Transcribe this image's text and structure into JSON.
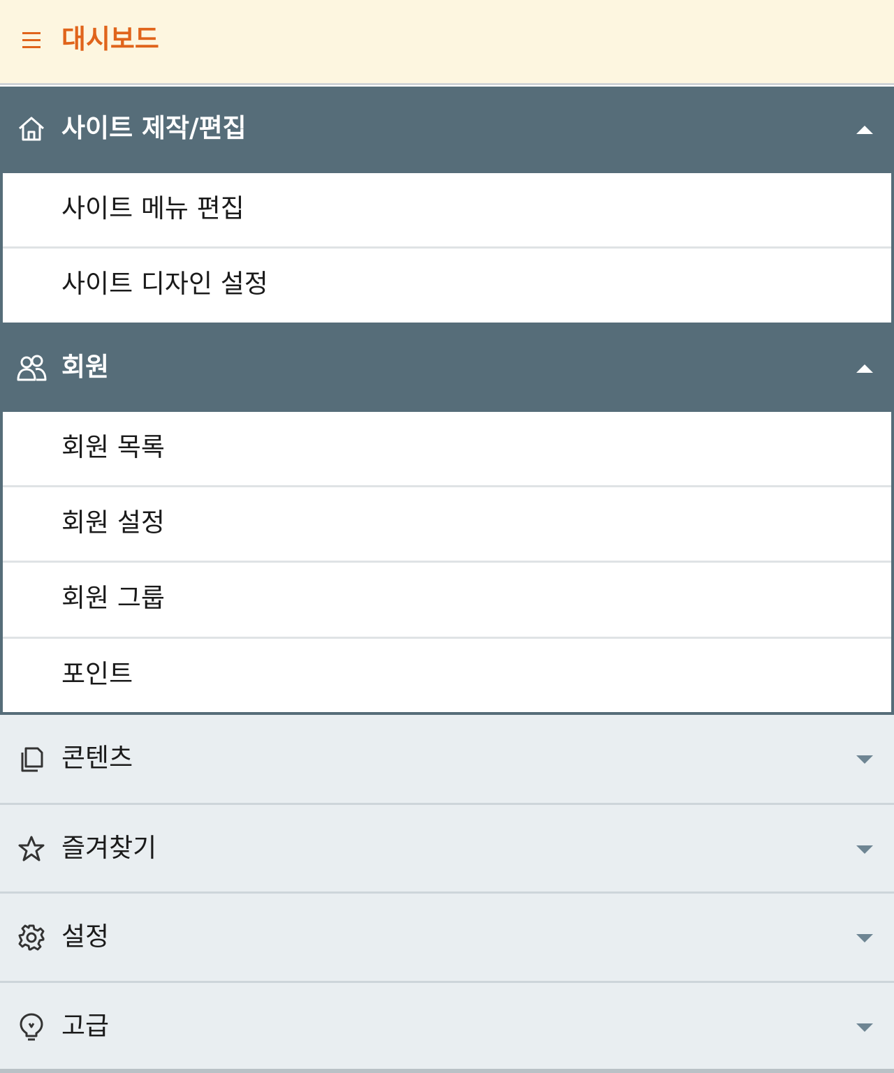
{
  "header": {
    "title": "대시보드",
    "menu_icon": "hamburger-icon",
    "accent_color": "#e0641b"
  },
  "sections": {
    "site": {
      "label": "사이트 제작/편집",
      "icon": "home-icon",
      "expanded": true,
      "items": [
        {
          "label": "사이트 메뉴 편집"
        },
        {
          "label": "사이트 디자인 설정"
        }
      ]
    },
    "member": {
      "label": "회원",
      "icon": "users-icon",
      "expanded": true,
      "items": [
        {
          "label": "회원 목록"
        },
        {
          "label": "회원 설정"
        },
        {
          "label": "회원 그룹"
        },
        {
          "label": "포인트"
        }
      ]
    },
    "content": {
      "label": "콘텐츠",
      "icon": "copy-icon",
      "expanded": false
    },
    "favorites": {
      "label": "즐겨찾기",
      "icon": "star-icon",
      "expanded": false
    },
    "settings": {
      "label": "설정",
      "icon": "gear-icon",
      "expanded": false
    },
    "advanced": {
      "label": "고급",
      "icon": "lightbulb-icon",
      "expanded": false
    }
  },
  "colors": {
    "section_header_bg": "#566d79",
    "collapsed_bg": "#e9eef1"
  }
}
